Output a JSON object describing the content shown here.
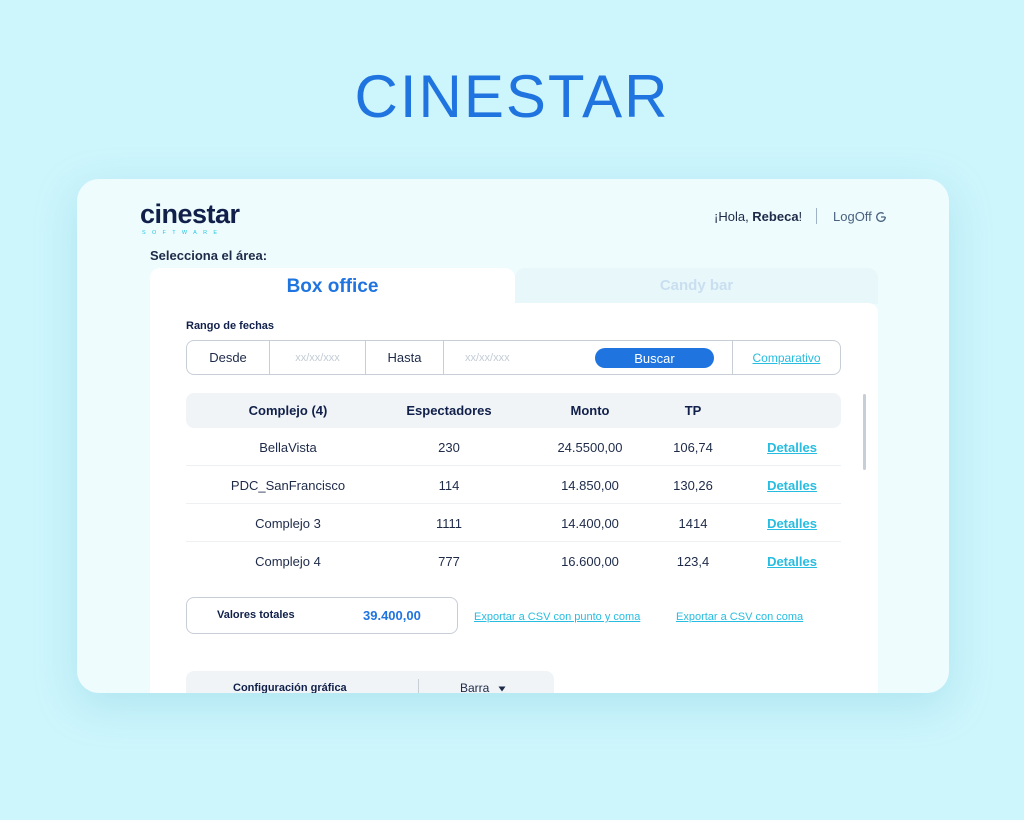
{
  "hero": {
    "title": "CINESTAR"
  },
  "header": {
    "logo_text": "cinestar",
    "logo_sub": "SOFTWARE",
    "greeting_prefix": "¡Hola, ",
    "user_name": "Rebeca",
    "greeting_suffix": "!",
    "logoff_label": "LogOff",
    "logoff_icon": "power-icon"
  },
  "area": {
    "label": "Selecciona el área:",
    "tabs": [
      {
        "label": "Box office",
        "active": true
      },
      {
        "label": "Candy bar",
        "active": false
      }
    ]
  },
  "filters": {
    "range_label": "Rango de fechas",
    "from_label": "Desde",
    "from_placeholder": "xx/xx/xxx",
    "to_label": "Hasta",
    "to_placeholder": "xx/xx/xxx",
    "search_button": "Buscar",
    "compare_link": "Comparativo"
  },
  "table": {
    "headers": [
      "Complejo (4)",
      "Espectadores",
      "Monto",
      "TP"
    ],
    "rows": [
      {
        "complejo": "BellaVista",
        "espectadores": "230",
        "monto": "24.5500,00",
        "tp": "106,74",
        "link": "Detalles"
      },
      {
        "complejo": "PDC_SanFrancisco",
        "espectadores": "114",
        "monto": "14.850,00",
        "tp": "130,26",
        "link": "Detalles"
      },
      {
        "complejo": "Complejo 3",
        "espectadores": "1111",
        "monto": "14.400,00",
        "tp": "1414",
        "link": "Detalles"
      },
      {
        "complejo": "Complejo 4",
        "espectadores": "777",
        "monto": "16.600,00",
        "tp": "123,4",
        "link": "Detalles"
      }
    ]
  },
  "totals": {
    "label": "Valores totales",
    "value": "39.400,00"
  },
  "export": {
    "semicolon_csv": "Exportar a CSV con punto y coma",
    "comma_csv": "Exportar a CSV con coma"
  },
  "chart_config": {
    "label": "Configuración gráfica",
    "selected": "Barra",
    "dropdown_icon": "triangle-down-icon"
  },
  "colors": {
    "accent": "#1f74e0",
    "link": "#27bde0",
    "background": "#cdf5fc"
  }
}
